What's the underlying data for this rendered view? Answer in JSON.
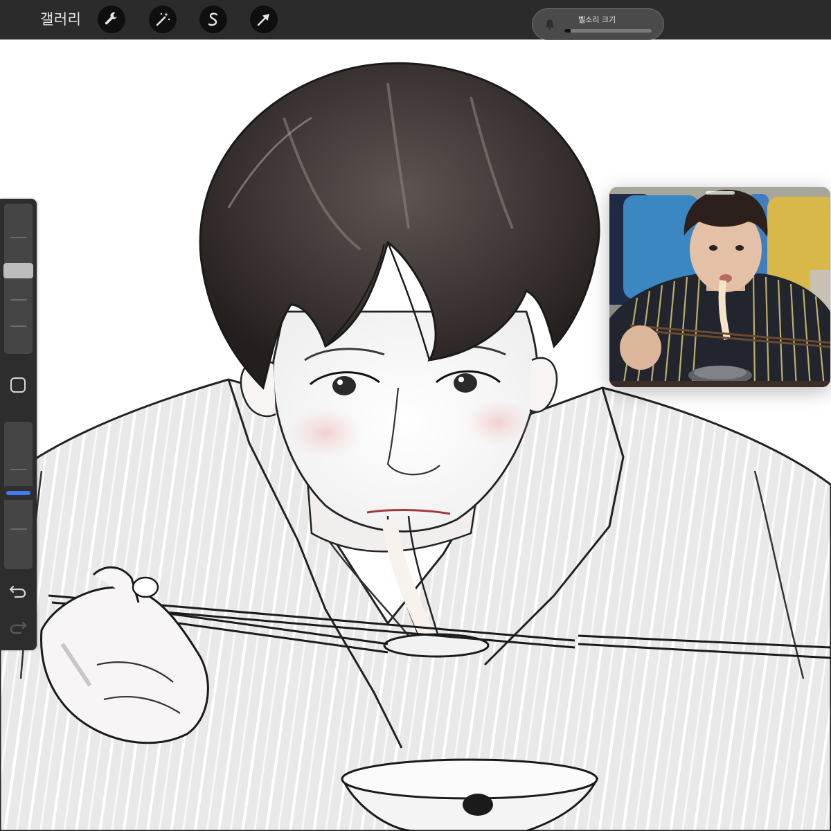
{
  "toolbar": {
    "gallery_label": "갤러리",
    "tools": [
      {
        "name": "actions",
        "icon": "wrench-icon"
      },
      {
        "name": "adjustments",
        "icon": "magic-wand-icon"
      },
      {
        "name": "selection",
        "icon": "selection-s-icon"
      },
      {
        "name": "transform",
        "icon": "arrow-cursor-icon"
      }
    ]
  },
  "volume_hud": {
    "title": "벨소리 크기",
    "icon": "bell-icon",
    "level": 0.07
  },
  "sidebar": {
    "brush_size_level": 0.56,
    "opacity_level": 0.52,
    "brush_size_handle_color": "#bdbdbd",
    "opacity_handle_color": "#3f7cf2",
    "modifier_icon": "square-modifier-icon",
    "undo_icon": "undo-icon",
    "redo_icon": "redo-icon"
  },
  "canvas": {
    "artwork": "pencil-sketch-artwork"
  },
  "pip": {
    "content": "video-call-feed"
  },
  "colors": {
    "toolbar_bg": "#2b2b2b",
    "sidebar_bg": "#2d2d2d",
    "accent_blue": "#3f7cf2"
  }
}
